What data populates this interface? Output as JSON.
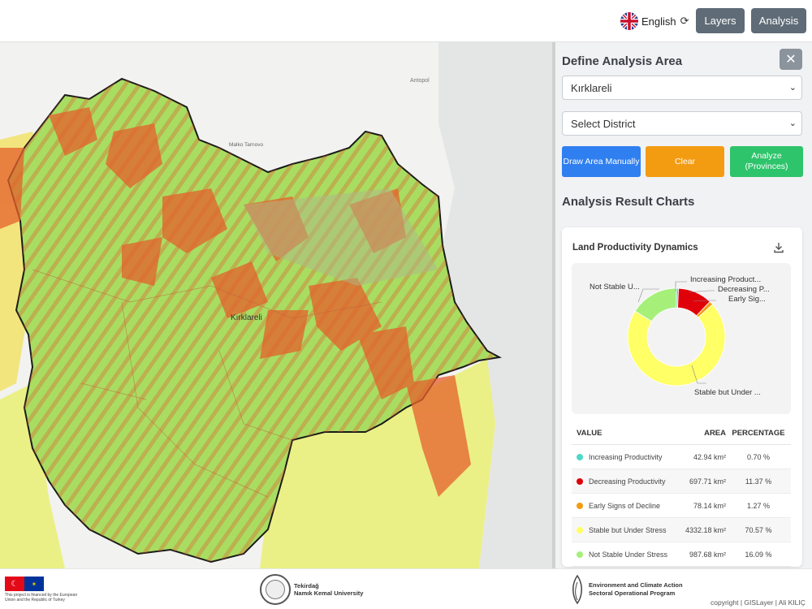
{
  "header": {
    "language": "English",
    "layers_label": "Layers",
    "analysis_label": "Analysis"
  },
  "map": {
    "labels": {
      "antopol": "Antopol",
      "malko": "Malko Tarnovo",
      "kirklareli": "Kırklareli"
    }
  },
  "panel": {
    "title": "Define Analysis Area",
    "close": "✕",
    "province_select": "Kırklareli",
    "district_select": "Select District",
    "draw_btn": "Draw Area Manually",
    "clear_btn": "Clear",
    "analyze_btn": "Analyze (Provinces)",
    "results_title": "Analysis Result Charts"
  },
  "card": {
    "title": "Land Productivity Dynamics",
    "download_icon": "download-icon",
    "labels": {
      "increasing": "Increasing Product...",
      "decreasing": "Decreasing P...",
      "early": "Early Sig...",
      "stable": "Stable but Under ...",
      "not_stable": "Not Stable U..."
    },
    "table": {
      "headers": [
        "VALUE",
        "AREA",
        "PERCENTAGE"
      ],
      "rows": [
        {
          "name": "Increasing Productivity",
          "area": "42.94 km²",
          "pct": "0.70 %",
          "color": "#4dd9c8"
        },
        {
          "name": "Decreasing Productivity",
          "area": "697.71 km²",
          "pct": "11.37 %",
          "color": "#e0000a"
        },
        {
          "name": "Early Signs of Decline",
          "area": "78.14 km²",
          "pct": "1.27 %",
          "color": "#f39c12"
        },
        {
          "name": "Stable but Under Stress",
          "area": "4332.18 km²",
          "pct": "70.57 %",
          "color": "#ffff66"
        },
        {
          "name": "Not Stable Under Stress",
          "area": "987.68 km²",
          "pct": "16.09 %",
          "color": "#a6f07a"
        }
      ]
    }
  },
  "chart_data": {
    "type": "pie",
    "title": "Land Productivity Dynamics",
    "categories": [
      "Increasing Productivity",
      "Decreasing Productivity",
      "Early Signs of Decline",
      "Stable but Under Stress",
      "Not Stable Under Stress"
    ],
    "values": [
      0.7,
      11.37,
      1.27,
      70.57,
      16.09
    ],
    "areas_km2": [
      42.94,
      697.71,
      78.14,
      4332.18,
      987.68
    ],
    "colors": [
      "#4dd9c8",
      "#e0000a",
      "#f39c12",
      "#ffff66",
      "#a6f07a"
    ],
    "donut": true
  },
  "footer": {
    "eu_text": "This project is financed by the European Union and the Republic of Turkey",
    "uni_line1": "Tekirdağ",
    "uni_line2": "Namık Kemal University",
    "env_line1": "Environment and Climate Action",
    "env_line2": "Sectoral Operational Program",
    "copyright": "copyright | GISLayer | Ali KILIÇ"
  }
}
